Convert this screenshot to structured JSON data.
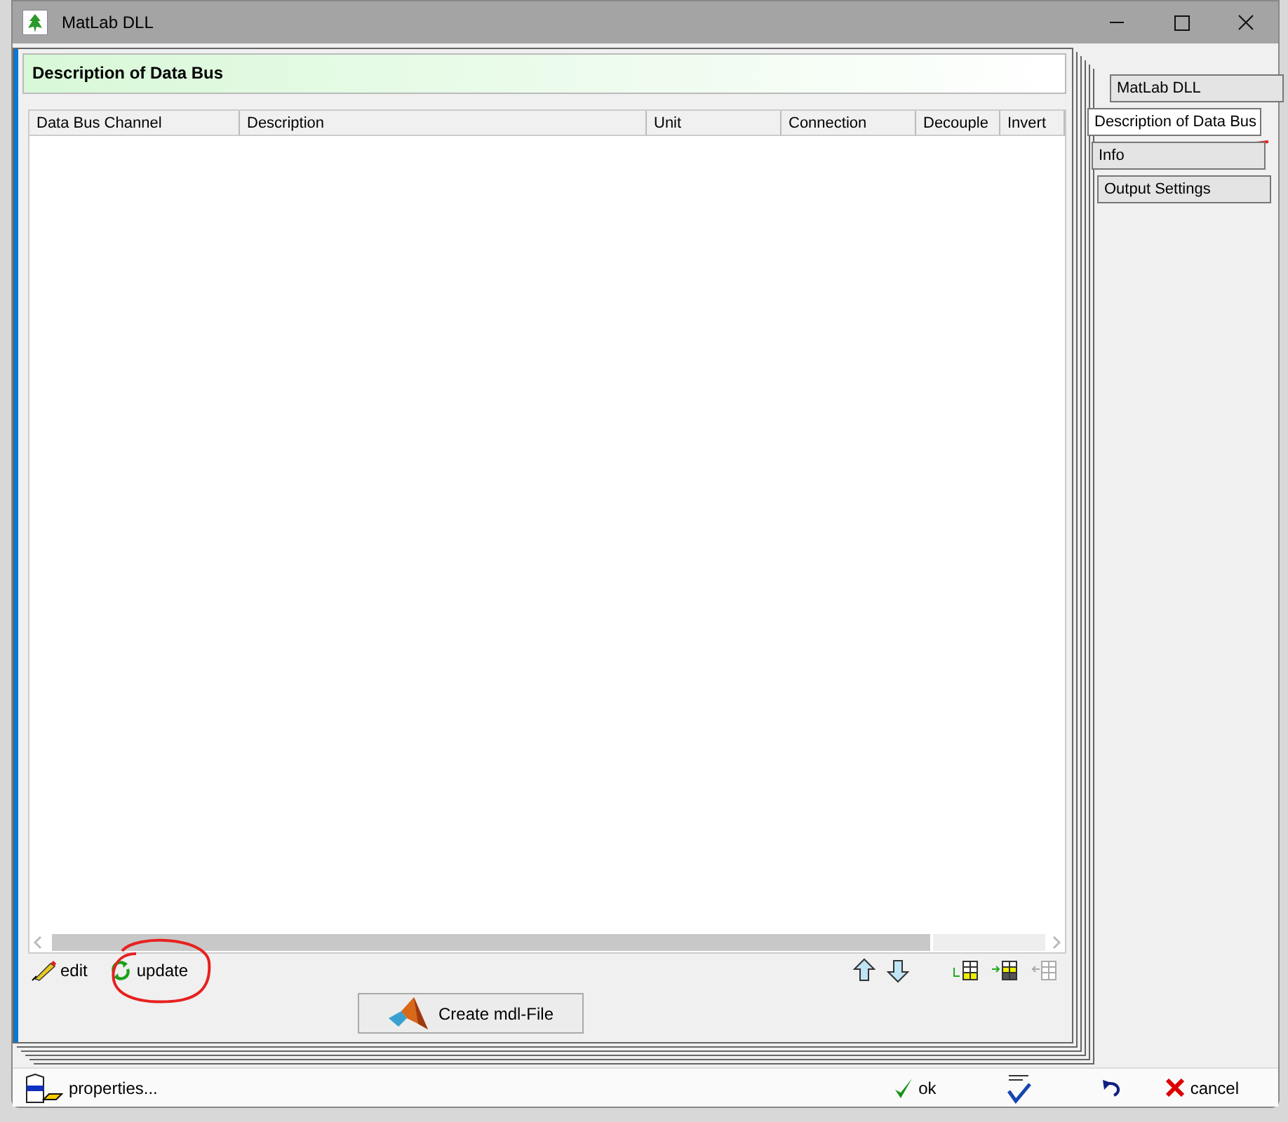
{
  "window": {
    "title": "MatLab DLL"
  },
  "page_title": "Description of Data Bus",
  "table": {
    "columns": [
      "Data Bus Channel",
      "Description",
      "Unit",
      "Connection",
      "Decouple",
      "Invert"
    ]
  },
  "toolbar": {
    "left": [
      {
        "kind": "edit",
        "label": "edit"
      },
      {
        "kind": "update",
        "label": "update"
      }
    ],
    "create_button": "Create mdl-File"
  },
  "tabs": [
    {
      "label": "MatLab DLL",
      "selected": false
    },
    {
      "label": "Description of Data Bus",
      "selected": true
    },
    {
      "label": "Info",
      "selected": false
    },
    {
      "label": "Output Settings",
      "selected": false
    }
  ],
  "footer": {
    "properties": "properties...",
    "ok": "ok",
    "cancel": "cancel"
  }
}
